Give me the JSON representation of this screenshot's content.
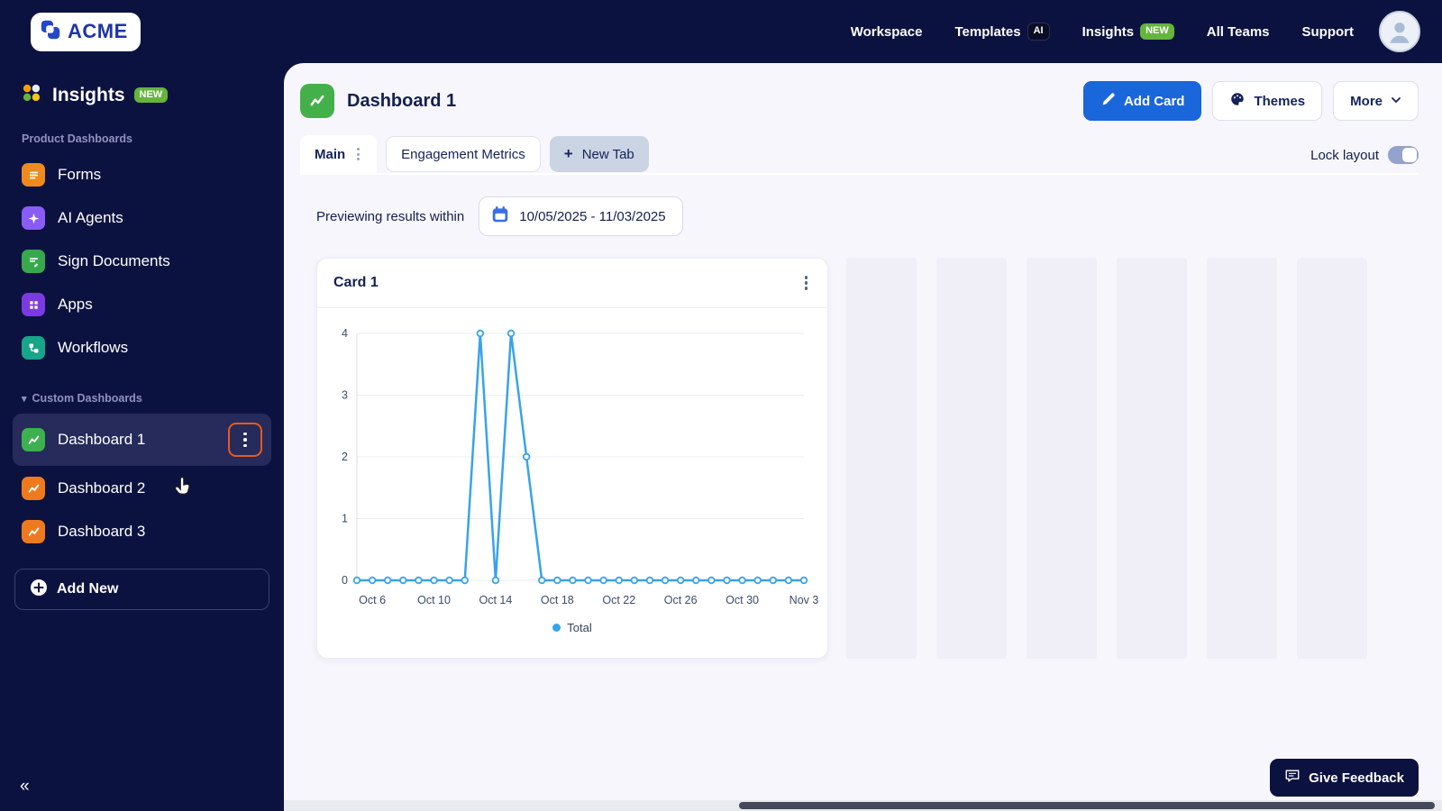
{
  "topbar": {
    "logo_text": "ACME",
    "nav": [
      {
        "label": "Workspace"
      },
      {
        "label": "Templates",
        "badge": "AI",
        "badge_style": "dark"
      },
      {
        "label": "Insights",
        "badge": "NEW",
        "badge_style": "green"
      },
      {
        "label": "All Teams"
      },
      {
        "label": "Support"
      }
    ]
  },
  "sidebar": {
    "app_label": "Insights",
    "app_badge": "NEW",
    "section1": "Product Dashboards",
    "items": [
      {
        "label": "Forms",
        "icon": "forms-icon",
        "glyph": "lines",
        "color": "#EF8A1E"
      },
      {
        "label": "AI Agents",
        "icon": "ai-agents-icon",
        "glyph": "sparkle",
        "color": "#8A5CF6"
      },
      {
        "label": "Sign Documents",
        "icon": "sign-documents-icon",
        "glyph": "docpen",
        "color": "#37A94C"
      },
      {
        "label": "Apps",
        "icon": "apps-icon",
        "glyph": "grid",
        "color": "#7A3BE0"
      },
      {
        "label": "Workflows",
        "icon": "workflows-icon",
        "glyph": "workflow",
        "color": "#18A58A"
      }
    ],
    "section2": "Custom Dashboards",
    "dashboards": [
      {
        "label": "Dashboard 1",
        "icon": "dashboard-icon",
        "glyph": "zigzag",
        "color": "#3CB14E",
        "active": true
      },
      {
        "label": "Dashboard 2",
        "icon": "dashboard-icon",
        "glyph": "zigzag",
        "color": "#EF7A1E",
        "active": false
      },
      {
        "label": "Dashboard 3",
        "icon": "dashboard-icon",
        "glyph": "zigzag",
        "color": "#EF7A1E",
        "active": false
      }
    ],
    "add_new": "Add New"
  },
  "main": {
    "title": "Dashboard 1",
    "buttons": {
      "add_card": "Add Card",
      "themes": "Themes",
      "more": "More"
    },
    "tabs": [
      {
        "label": "Main",
        "active": true
      },
      {
        "label": "Engagement Metrics",
        "active": false
      },
      {
        "label": "New Tab",
        "active": false
      }
    ],
    "lock_layout": "Lock layout",
    "preview_label": "Previewing results within",
    "date_range": "10/05/2025 - 11/03/2025",
    "card": {
      "title": "Card 1"
    },
    "feedback": "Give Feedback"
  },
  "chart_data": {
    "type": "line",
    "title": "Card 1",
    "x": [
      "Oct 5",
      "Oct 6",
      "Oct 7",
      "Oct 8",
      "Oct 9",
      "Oct 10",
      "Oct 11",
      "Oct 12",
      "Oct 13",
      "Oct 14",
      "Oct 15",
      "Oct 16",
      "Oct 17",
      "Oct 18",
      "Oct 19",
      "Oct 20",
      "Oct 21",
      "Oct 22",
      "Oct 23",
      "Oct 24",
      "Oct 25",
      "Oct 26",
      "Oct 27",
      "Oct 28",
      "Oct 29",
      "Oct 30",
      "Oct 31",
      "Nov 1",
      "Nov 2",
      "Nov 3"
    ],
    "series": [
      {
        "name": "Total",
        "values": [
          0,
          0,
          0,
          0,
          0,
          0,
          0,
          0,
          4,
          0,
          4,
          2,
          0,
          0,
          0,
          0,
          0,
          0,
          0,
          0,
          0,
          0,
          0,
          0,
          0,
          0,
          0,
          0,
          0,
          0
        ]
      }
    ],
    "tick_indices": [
      1,
      5,
      9,
      13,
      17,
      21,
      25,
      29
    ],
    "yticks": [
      0,
      1,
      2,
      3,
      4
    ],
    "ylim": [
      0,
      4
    ],
    "grid": true,
    "legend_position": "bottom",
    "line_color": "#38A3EA"
  }
}
